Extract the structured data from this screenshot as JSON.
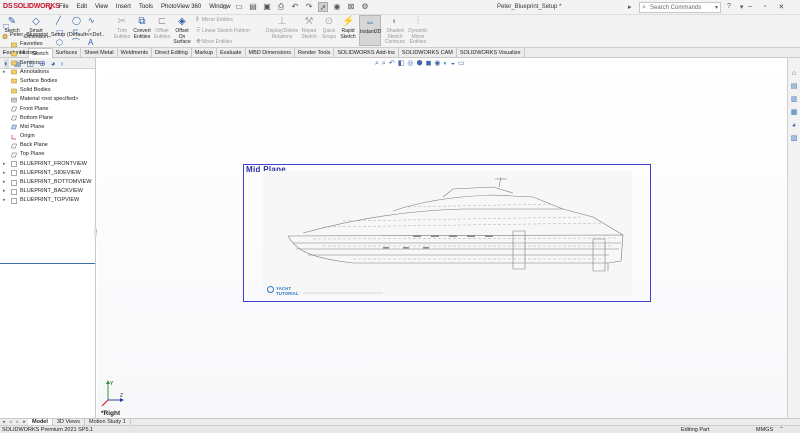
{
  "app": {
    "brand": "SOLIDWORKS",
    "brand_prefix": "DS",
    "document_title": "Peter_Blueprint_Setup *",
    "search_placeholder": "Search Commands"
  },
  "menu": [
    "File",
    "Edit",
    "View",
    "Insert",
    "Tools",
    "PhotoView 360",
    "Window"
  ],
  "ribbon": {
    "sketch": "Sketch",
    "smart_dimension": [
      "Smart",
      "Dimension"
    ],
    "trim_entities": [
      "Trim",
      "Entities"
    ],
    "convert_entities": [
      "Convert",
      "Entities"
    ],
    "offset_entities": [
      "Offset",
      "Entities"
    ],
    "offset_on_surface": [
      "Offset",
      "On",
      "Surface"
    ],
    "mirror_entities": "Mirror Entities",
    "linear_sketch_pattern": "Linear Sketch Pattern",
    "move_entities": "Move Entities",
    "display_delete_relations": [
      "Display/Delete",
      "Relations"
    ],
    "repair_sketch": [
      "Repair",
      "Sketch"
    ],
    "quick_snaps": [
      "Quick",
      "Snaps"
    ],
    "rapid_sketch": [
      "Rapid",
      "Sketch"
    ],
    "instant2d": "Instant2D",
    "shaded_sketch_contours": [
      "Shaded",
      "Sketch",
      "Contours"
    ],
    "dynamic_mirror_entities": [
      "Dynamic",
      "Mirror",
      "Entities"
    ]
  },
  "command_tabs": [
    "Features",
    "Sketch",
    "Surfaces",
    "Sheet Metal",
    "Weldments",
    "Direct Editing",
    "Markup",
    "Evaluate",
    "MBD Dimensions",
    "Render Tools",
    "SOLIDWORKS Add-Ins",
    "SOLIDWORKS CAM",
    "SOLIDWORKS Visualize"
  ],
  "active_command_tab": "Sketch",
  "feature_tree": {
    "root": "Peter_Blueprint_Setup  (Default<<Def..",
    "items": [
      {
        "label": "Favorites",
        "icon": "favorites-folder-icon",
        "expandable": false
      },
      {
        "label": "History",
        "icon": "history-icon",
        "expandable": true
      },
      {
        "label": "Sensors",
        "icon": "sensors-folder-icon",
        "expandable": false
      },
      {
        "label": "Annotations",
        "icon": "annotations-icon",
        "expandable": true
      },
      {
        "label": "Surface Bodies",
        "icon": "surface-bodies-icon",
        "expandable": false
      },
      {
        "label": "Solid Bodies",
        "icon": "solid-bodies-icon",
        "expandable": false
      },
      {
        "label": "Material <not specified>",
        "icon": "material-icon",
        "expandable": false
      },
      {
        "label": "Front Plane",
        "icon": "plane-icon",
        "expandable": false
      },
      {
        "label": "Bottom Plane",
        "icon": "plane-icon",
        "expandable": false
      },
      {
        "label": "Mid Plane",
        "icon": "plane-icon",
        "expandable": false
      },
      {
        "label": "Origin",
        "icon": "origin-icon",
        "expandable": false
      },
      {
        "label": "Back Plane",
        "icon": "plane-icon",
        "expandable": false
      },
      {
        "label": "Top Plane",
        "icon": "plane-icon",
        "expandable": false
      },
      {
        "label": "BLUEPRINT_FRONTVIEW",
        "icon": "sketch-picture-icon",
        "expandable": true
      },
      {
        "label": "BLUEPRINT_SIDEVIEW",
        "icon": "sketch-picture-icon",
        "expandable": true
      },
      {
        "label": "BLUEPRINT_BOTTOMVIEW",
        "icon": "sketch-picture-icon",
        "expandable": true
      },
      {
        "label": "BLUEPRINT_BACKVIEW",
        "icon": "sketch-picture-icon",
        "expandable": true
      },
      {
        "label": "BLUEPRINT_TOPVIEW",
        "icon": "sketch-picture-icon",
        "expandable": true
      }
    ]
  },
  "viewport": {
    "plane_label": "Mid Plane",
    "view_label": "*Right",
    "blueprint_brand": [
      "YACHT",
      "TUTORIAL"
    ]
  },
  "bottom_tabs": [
    "Model",
    "3D Views",
    "Motion Study 1"
  ],
  "active_bottom_tab": "Model",
  "status": {
    "version": "SOLIDWORKS Premium 2021 SP5.1",
    "mode": "Editing Part",
    "units": "MMGS"
  },
  "colors": {
    "brand_red": "#c8102e",
    "plane_blue": "#3f3fd0",
    "icon_blue": "#2a5fa8"
  }
}
